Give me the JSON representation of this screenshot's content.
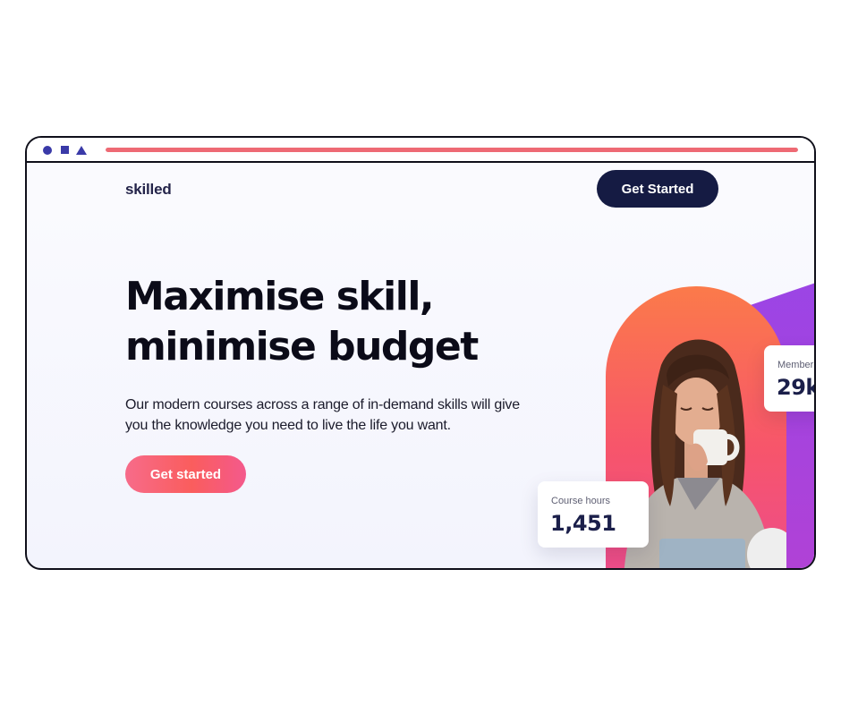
{
  "header": {
    "logo": "skilled",
    "cta_label": "Get Started"
  },
  "hero": {
    "headline_line1": "Maximise skill,",
    "headline_line2": "minimise budget",
    "description": "Our modern courses across a range of in-demand skills will give you the knowledge you need to live the life you want.",
    "cta_label": "Get started"
  },
  "stats": {
    "course_hours": {
      "label": "Course hours",
      "value": "1,451"
    },
    "members": {
      "label": "Member",
      "value": "29k"
    }
  },
  "window_chrome": {
    "progress_fraction": 1.0
  },
  "colors": {
    "navy": "#151b43",
    "accent_coral": "#ee6a74",
    "gradient_orange": "#fb7a4a",
    "gradient_pink": "#ec4c8d",
    "purple": "#9a45e6"
  }
}
